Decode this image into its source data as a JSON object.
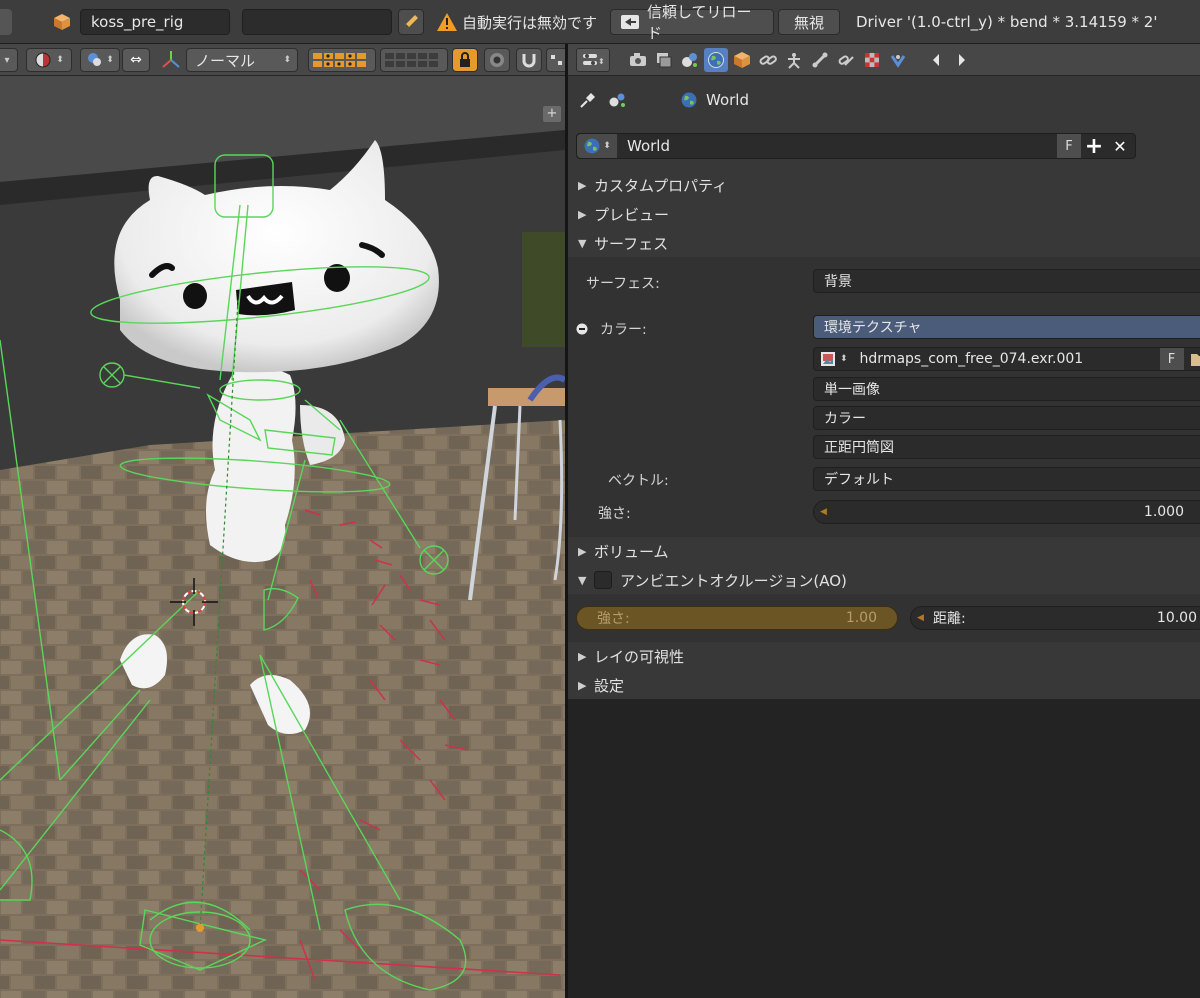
{
  "topbar": {
    "scene_name": "koss_pre_rig",
    "empty_field": "",
    "warning_text": "自動実行は無効です",
    "reload_button": "信頼してリロード",
    "ignore_button": "無視",
    "driver_text": "Driver '(1.0-ctrl_y) * bend * 3.14159 * 2'"
  },
  "viewport_header": {
    "orientation_label": "ノーマル"
  },
  "properties": {
    "breadcrumb": "World",
    "world_selector": {
      "name": "World",
      "fake_user": "F",
      "add": "+",
      "remove": "✕"
    },
    "panels": {
      "custom_props": "カスタムプロパティ",
      "preview": "プレビュー",
      "surface": "サーフェス",
      "volume": "ボリューム",
      "ao": "アンビエントオクルージョン(AO)",
      "ray_visibility": "レイの可視性",
      "settings": "設定"
    },
    "surface": {
      "surface_label": "サーフェス:",
      "surface_value": "背景",
      "color_label": "カラー:",
      "color_value": "環境テクスチャ",
      "image_name": "hdrmaps_com_free_074.exr.001",
      "image_fake_user": "F",
      "source": "単一画像",
      "color_space": "カラー",
      "projection": "正距円筒図",
      "vector_label": "ベクトル:",
      "vector_value": "デフォルト",
      "strength_label": "強さ:",
      "strength_value": "1.000"
    },
    "ao": {
      "strength_label": "強さ:",
      "strength_value": "1.00",
      "distance_label": "距離:",
      "distance_value": "10.00"
    }
  },
  "colors": {
    "accent_blue": "#5680c2",
    "rig_green": "#55d255",
    "disabled_orange": "#6b5525"
  }
}
